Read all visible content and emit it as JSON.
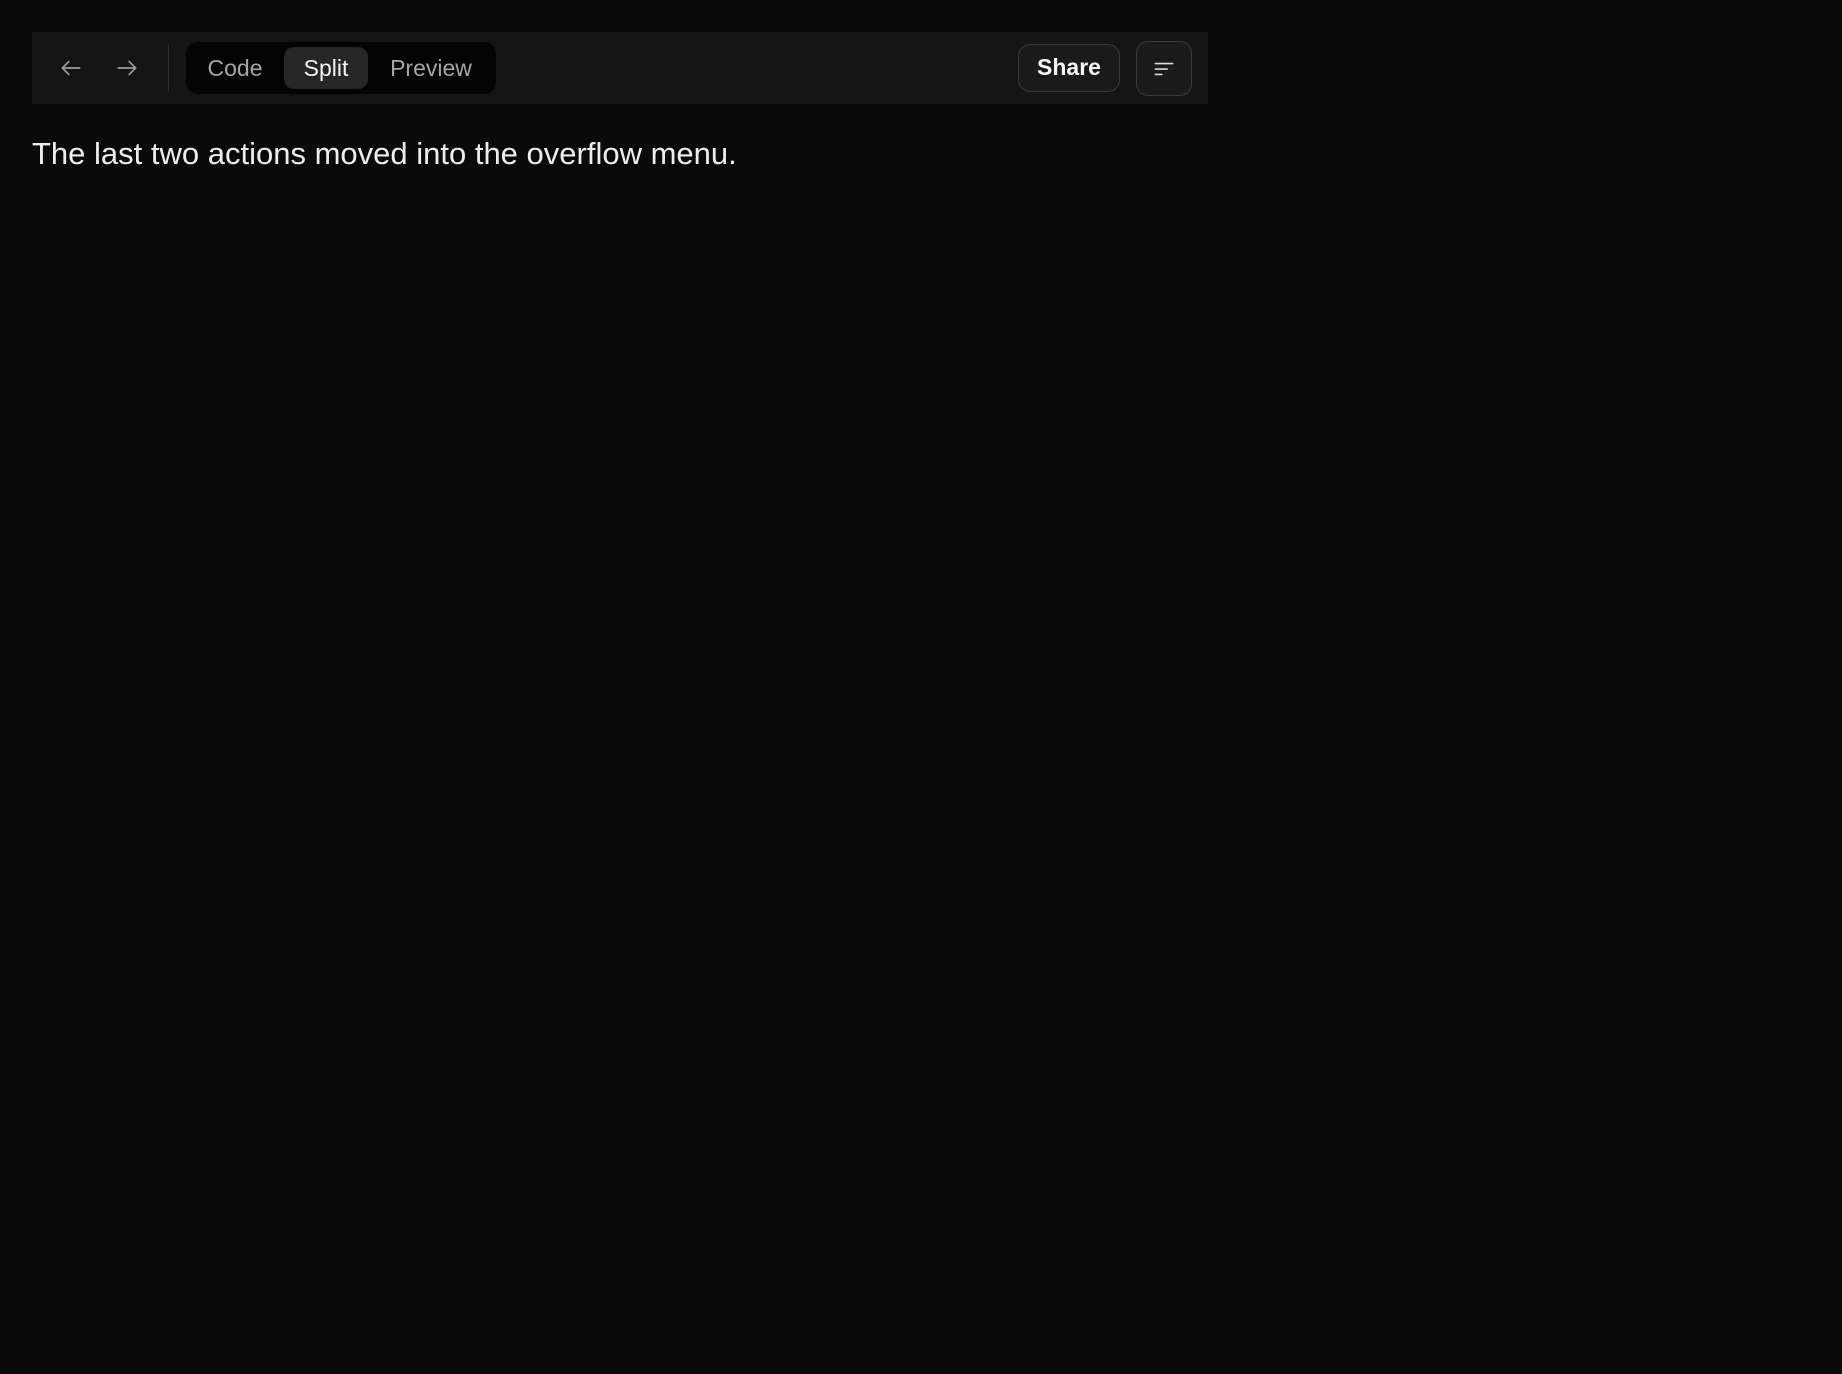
{
  "toolbar": {
    "nav": {
      "back_icon": "arrow-left-icon",
      "forward_icon": "arrow-right-icon"
    },
    "view_modes": [
      {
        "label": "Code",
        "selected": false
      },
      {
        "label": "Split",
        "selected": true
      },
      {
        "label": "Preview",
        "selected": false
      }
    ],
    "share_label": "Share",
    "overflow_icon": "menu-lines-icon"
  },
  "main": {
    "message": "The last two actions moved into the overflow menu."
  },
  "colors": {
    "background": "#0a0a0a",
    "toolbar": "#141414",
    "segment_track": "#030303",
    "segment_selected": "#262626",
    "text_primary": "#ececec",
    "text_muted": "#a6a6a6"
  }
}
